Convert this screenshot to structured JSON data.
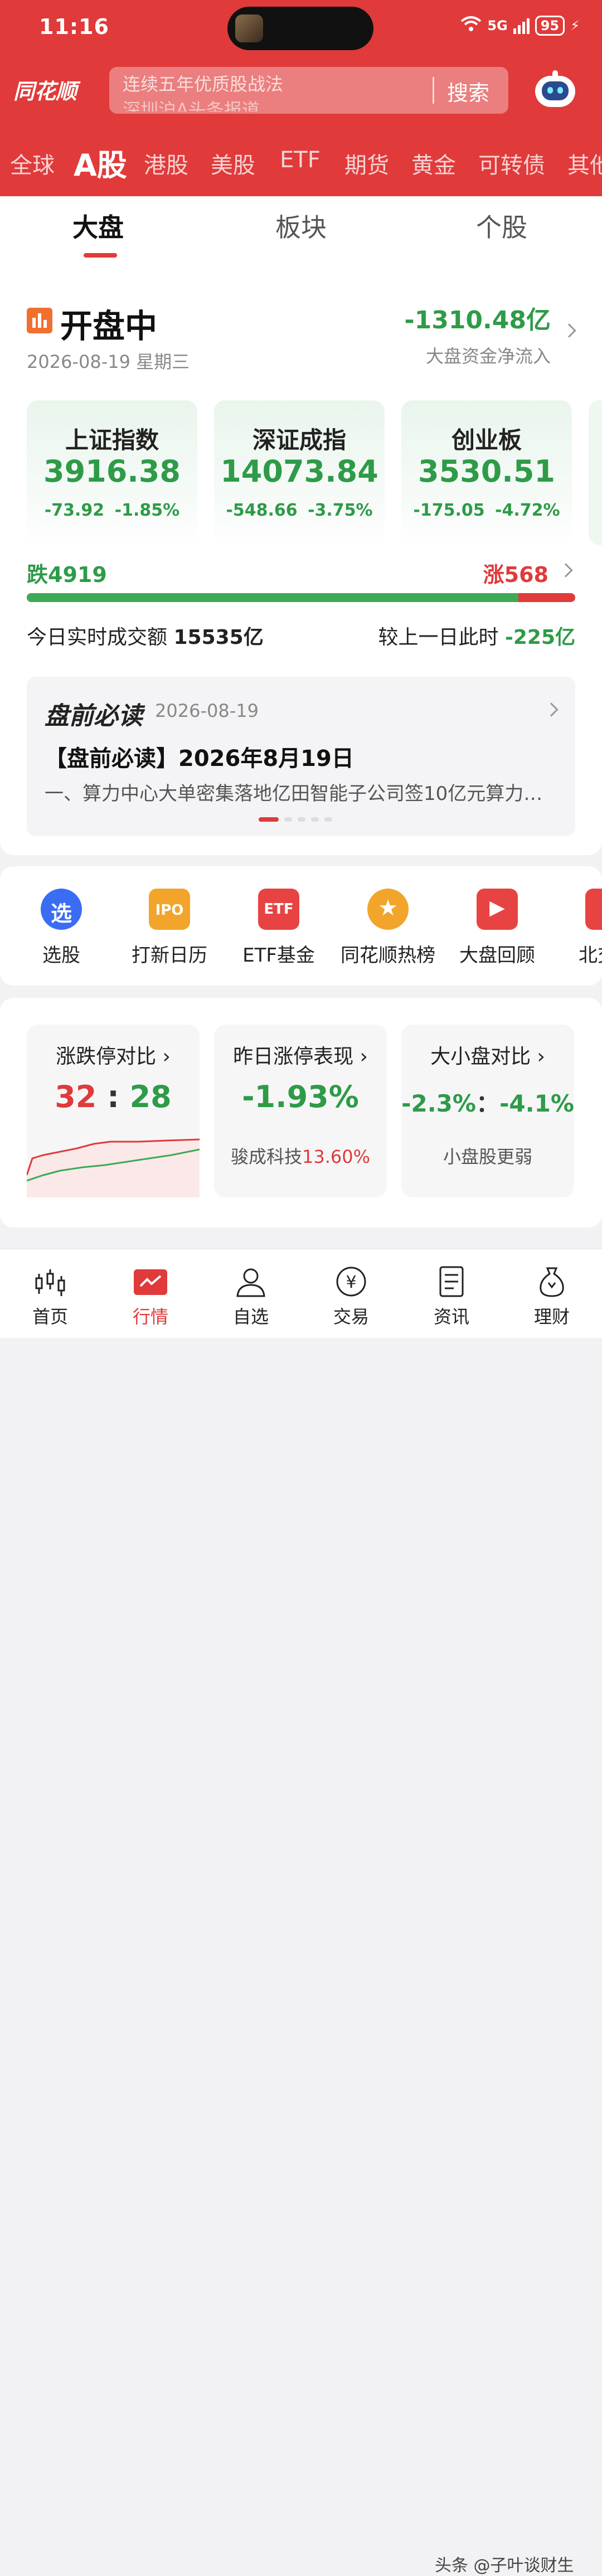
{
  "status_bar": {
    "time": "11:16",
    "network": "5G",
    "battery": "95"
  },
  "header": {
    "logo": "同花顺",
    "search_line1": "连续五年优质股战法",
    "search_line2": "深圳沪A头条报道",
    "search_button": "搜索"
  },
  "market_tabs": [
    "全球",
    "A股",
    "港股",
    "美股",
    "ETF",
    "期货",
    "黄金",
    "可转债",
    "其他"
  ],
  "sub_tabs": [
    "大盘",
    "板块",
    "个股"
  ],
  "market": {
    "status": "开盘中",
    "date": "2026-08-19 星期三",
    "net_flow": "-1310.48亿",
    "net_flow_label": "大盘资金净流入"
  },
  "indices": [
    {
      "name": "上证指数",
      "value": "3916.38",
      "change": "-73.92",
      "pct": "-1.85%"
    },
    {
      "name": "深证成指",
      "value": "14073.84",
      "change": "-548.66",
      "pct": "-3.75%"
    },
    {
      "name": "创业板",
      "value": "3530.51",
      "change": "-175.05",
      "pct": "-4.72%"
    }
  ],
  "breadth": {
    "fall_label": "跌4919",
    "rise_label": "涨568",
    "fall_fraction": 0.896
  },
  "turnover": {
    "label": "今日实时成交额",
    "value": "15535亿",
    "compare_label": "较上一日此时",
    "compare_value": "-225亿"
  },
  "news": {
    "brand": "盘前必读",
    "date": "2026-08-19",
    "title": "【盘前必读】2026年8月19日",
    "body": "一、算力中心大单密集落地亿田智能子公司签10亿元算力服务合同..."
  },
  "shortcuts": [
    "选股",
    "打新日历",
    "ETF基金",
    "同花顺热榜",
    "大盘回顾",
    "北交所"
  ],
  "shortcut_icons": [
    "xuan-icon",
    "ipo-calendar-icon",
    "etf-icon",
    "hot-list-icon",
    "market-review-icon",
    "bse-icon"
  ],
  "cards": {
    "limit": {
      "title": "涨跌停对比",
      "up": "32",
      "sep": ":",
      "down": "28"
    },
    "yesterday": {
      "title": "昨日涨停表现",
      "value": "-1.93%",
      "stock": "骏成科技",
      "stock_pct": "13.60%"
    },
    "size": {
      "title": "大小盘对比",
      "big": "-2.3%",
      "sep": "：",
      "small": "-4.1%",
      "note": "小盘股更弱"
    }
  },
  "tab_bar": [
    "首页",
    "行情",
    "自选",
    "交易",
    "资讯",
    "理财"
  ],
  "watermark": "头条 @子叶谈财生",
  "colors": {
    "brand_red": "#e03a3a",
    "down_green": "#2e9b48",
    "up_red": "#e03a3a"
  }
}
